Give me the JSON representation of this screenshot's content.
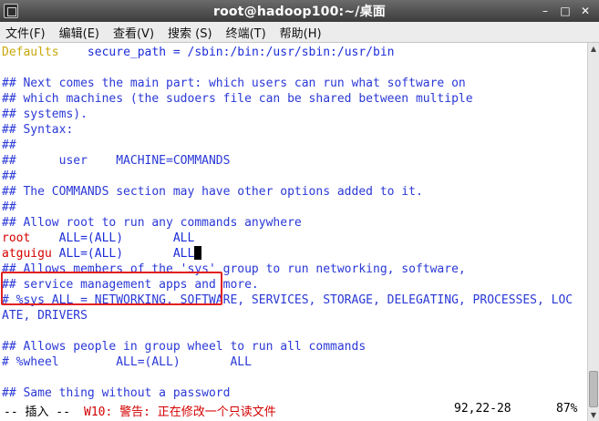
{
  "window": {
    "title": "root@hadoop100:~/桌面"
  },
  "menu": [
    {
      "label": "文件(F)"
    },
    {
      "label": "编辑(E)"
    },
    {
      "label": "查看(V)"
    },
    {
      "label": "搜索 (S)"
    },
    {
      "label": "终端(T)"
    },
    {
      "label": "帮助(H)"
    }
  ],
  "lines": [
    {
      "a": "Defaults",
      "b": "    secure_path = /sbin:/bin:/usr/sbin:/usr/bin"
    },
    {
      "a": "",
      "b": ""
    },
    {
      "a": "",
      "b": "## Next comes the main part: which users can run what software on"
    },
    {
      "a": "",
      "b": "## which machines (the sudoers file can be shared between multiple"
    },
    {
      "a": "",
      "b": "## systems)."
    },
    {
      "a": "",
      "b": "## Syntax:"
    },
    {
      "a": "",
      "b": "##"
    },
    {
      "a": "",
      "b": "##      user    MACHINE=COMMANDS"
    },
    {
      "a": "",
      "b": "##"
    },
    {
      "a": "",
      "b": "## The COMMANDS section may have other options added to it."
    },
    {
      "a": "",
      "b": "##"
    },
    {
      "a": "",
      "b": "## Allow root to run any commands anywhere"
    },
    {
      "a": "root",
      "b": "    ALL=(ALL)       ALL"
    },
    {
      "a": "atguigu",
      "b": " ALL=(ALL)       ALL"
    },
    {
      "a": "",
      "b": "## Allows members of the 'sys' group to run networking, software,"
    },
    {
      "a": "",
      "b": "## service management apps and more."
    },
    {
      "a": "",
      "b": "# %sys ALL = NETWORKING, SOFTWARE, SERVICES, STORAGE, DELEGATING, PROCESSES, LOC"
    },
    {
      "a": "",
      "b": "ATE, DRIVERS"
    },
    {
      "a": "",
      "b": ""
    },
    {
      "a": "",
      "b": "## Allows people in group wheel to run all commands"
    },
    {
      "a": "",
      "b": "# %wheel        ALL=(ALL)       ALL"
    },
    {
      "a": "",
      "b": ""
    },
    {
      "a": "",
      "b": "## Same thing without a password"
    }
  ],
  "status": {
    "mode": "-- 插入 --",
    "warning": "W10: 警告: 正在修改一个只读文件",
    "position": "92,22-28",
    "percent": "87%"
  },
  "colors": {
    "comment": "#2a38d6",
    "keyword": "#c9a80a",
    "user": "#d40000",
    "box": "#e32020"
  }
}
